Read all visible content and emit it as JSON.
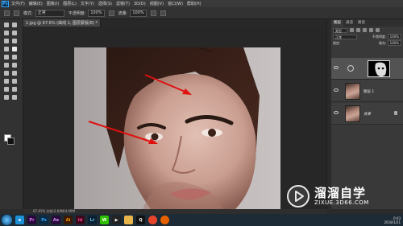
{
  "menubar": {
    "logo": "Ps",
    "items": [
      "文件(F)",
      "编辑(E)",
      "图像(I)",
      "图层(L)",
      "文字(Y)",
      "选择(S)",
      "滤镜(T)",
      "3D(D)",
      "视图(V)",
      "窗口(W)",
      "帮助(H)"
    ]
  },
  "options_bar": {
    "mode_label": "模式:",
    "mode_value": "正常",
    "opacity_label": "不透明度:",
    "opacity_value": "100%",
    "flow_label": "流量:",
    "flow_value": "100%"
  },
  "document": {
    "tab_title": "1.jpg @ 67.6% (曲线 1, 图层蒙版/8) *",
    "status_text": "67.61%    文档:2.64M/4.49M"
  },
  "layers_panel": {
    "tabs": [
      "图层",
      "通道",
      "路径"
    ],
    "filter_label": "类型",
    "blend_mode": "正常",
    "opacity_label": "不透明度:",
    "opacity_value": "100%",
    "lock_label": "锁定:",
    "fill_label": "填充:",
    "fill_value": "100%",
    "layers": [
      {
        "name": "",
        "type": "adjustment"
      },
      {
        "name": "图层 1",
        "type": "pixel"
      },
      {
        "name": "背景",
        "type": "background"
      }
    ]
  },
  "watermark": {
    "title": "溜溜自学",
    "url": "ZIXUE.3D66.COM"
  },
  "taskbar": {
    "icons": [
      {
        "name": "ie-icon",
        "label": "e",
        "bg": "#1e90d8",
        "fg": "#ffffff"
      },
      {
        "name": "premiere-icon",
        "label": "Pr",
        "bg": "#2a0a3a",
        "fg": "#e27bff"
      },
      {
        "name": "photoshop-icon",
        "label": "Ps",
        "bg": "#0a2a45",
        "fg": "#31a8ff"
      },
      {
        "name": "after-effects-icon",
        "label": "Ae",
        "bg": "#2a0a3a",
        "fg": "#cf96fd"
      },
      {
        "name": "illustrator-icon",
        "label": "Ai",
        "bg": "#3a1a00",
        "fg": "#ff9a00"
      },
      {
        "name": "indesign-icon",
        "label": "Id",
        "bg": "#3a0a1a",
        "fg": "#ff3f94"
      },
      {
        "name": "lightroom-icon",
        "label": "Lr",
        "bg": "#0a2233",
        "fg": "#6dc2e9"
      },
      {
        "name": "wechat-icon",
        "label": "W",
        "bg": "#2dc100",
        "fg": "#ffffff"
      },
      {
        "name": "media-player-icon",
        "label": "▶",
        "bg": "#222",
        "fg": "#ffffff"
      },
      {
        "name": "folder-icon",
        "label": "",
        "bg": "#e8b54a",
        "fg": "#ffffff"
      },
      {
        "name": "qq-icon",
        "label": "Q",
        "bg": "#111",
        "fg": "#ffffff"
      },
      {
        "name": "chrome-icon",
        "label": "",
        "bg": "#e8442c",
        "fg": "#ffffff"
      },
      {
        "name": "firefox-icon",
        "label": "",
        "bg": "#e66000",
        "fg": "#ffffff"
      }
    ],
    "time": "0:03",
    "date": "2018/1/21"
  }
}
